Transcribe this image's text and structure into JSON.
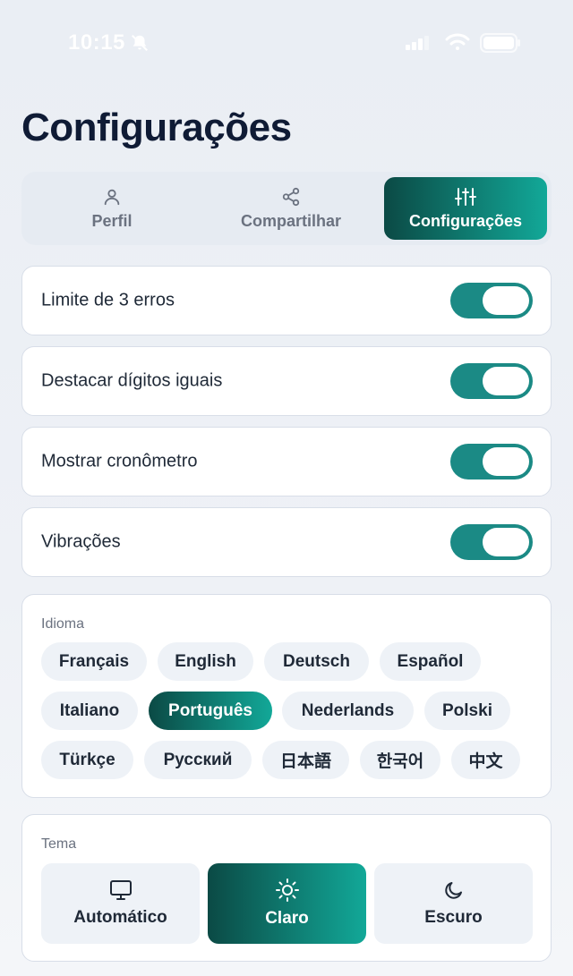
{
  "status_bar": {
    "time": "10:15"
  },
  "page": {
    "title": "Configurações"
  },
  "tabs": [
    {
      "label": "Perfil",
      "icon": "user-icon"
    },
    {
      "label": "Compartilhar",
      "icon": "share-icon"
    },
    {
      "label": "Configurações",
      "icon": "sliders-icon",
      "active": true
    }
  ],
  "toggles": [
    {
      "label": "Limite de 3 erros",
      "on": true
    },
    {
      "label": "Destacar dígitos iguais",
      "on": true
    },
    {
      "label": "Mostrar cronômetro",
      "on": true
    },
    {
      "label": "Vibrações",
      "on": true
    }
  ],
  "language": {
    "label": "Idioma",
    "options": [
      "Français",
      "English",
      "Deutsch",
      "Español",
      "Italiano",
      "Português",
      "Nederlands",
      "Polski",
      "Türkçe",
      "Русский",
      "日本語",
      "한국어",
      "中文"
    ],
    "selected": "Português"
  },
  "theme": {
    "label": "Tema",
    "options": [
      {
        "label": "Automático",
        "icon": "monitor-icon"
      },
      {
        "label": "Claro",
        "icon": "sun-icon",
        "active": true
      },
      {
        "label": "Escuro",
        "icon": "moon-icon"
      }
    ]
  },
  "colors": {
    "accent_dark": "#0b4a45",
    "accent_light": "#12a898",
    "toggle_on": "#1b8a85"
  }
}
